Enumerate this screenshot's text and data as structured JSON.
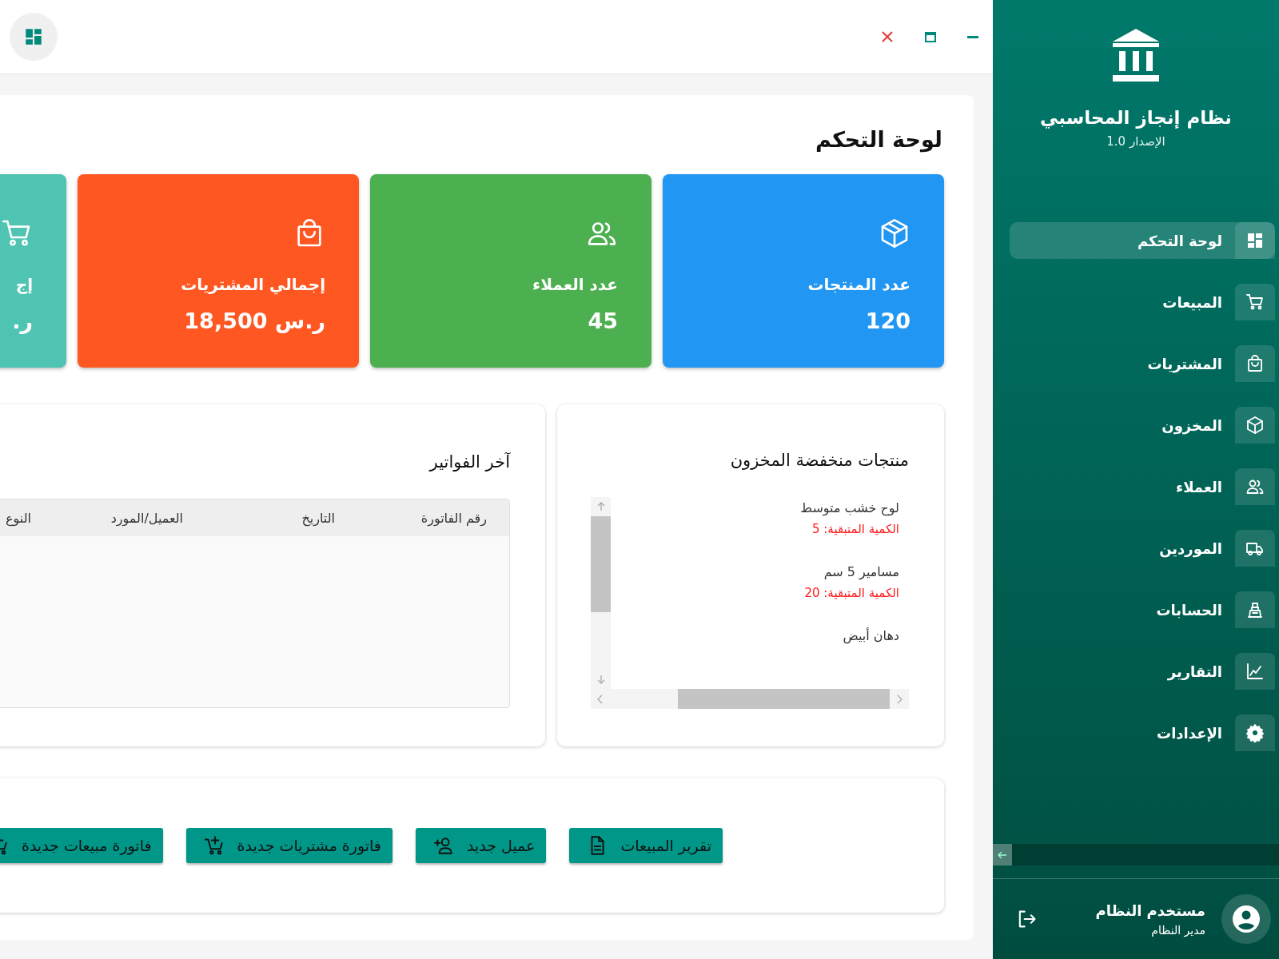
{
  "window_controls": [
    {
      "kind": "close"
    },
    {
      "kind": "maximize"
    },
    {
      "kind": "minimize"
    }
  ],
  "page_title": "لوحة التحكم",
  "stat_cards": [
    {
      "kind": "box",
      "title": "عدد المنتجات",
      "value": "120",
      "color": "#2196f3"
    },
    {
      "kind": "people",
      "title": "عدد العملاء",
      "value": "45",
      "color": "#4caf50"
    },
    {
      "kind": "bag",
      "title": "إجمالي المشتريات",
      "value": "ر.س 18,500",
      "color": "#ff5722"
    },
    {
      "kind": "cart",
      "title": "إج",
      "value": "ر.",
      "color": "#4fc4b3"
    }
  ],
  "low_stock": {
    "title": "منتجات منخفضة المخزون",
    "items": [
      {
        "name": "لوح خشب متوسط",
        "quantity": "الكمية المتبقية: 5"
      },
      {
        "name": "مسامير 5 سم",
        "quantity": "الكمية المتبقية: 20"
      },
      {
        "name": "دهان أبيض"
      }
    ]
  },
  "recent_invoices": {
    "title": "آخر الفواتير",
    "columns": [
      "رقم الفاتورة",
      "التاريخ",
      "العميل/المورد",
      "النوع"
    ]
  },
  "quick_actions": [
    {
      "kind": "report",
      "label": "تقرير المبيعات"
    },
    {
      "kind": "add-person",
      "label": "عميل جديد"
    },
    {
      "kind": "add-cart",
      "label": "فاتورة مشتريات جديدة"
    },
    {
      "kind": "add-cart",
      "label": "فاتورة مبيعات جديدة"
    }
  ],
  "sidebar": {
    "app_title": "نظام إنجاز المحاسبي",
    "version": "الإصدار 1.0",
    "items": [
      {
        "kind": "dashboard",
        "label": "لوحة التحكم",
        "selected": true
      },
      {
        "kind": "cart",
        "label": "المبيعات",
        "selected": false
      },
      {
        "kind": "bag",
        "label": "المشتريات",
        "selected": false
      },
      {
        "kind": "box",
        "label": "المخزون",
        "selected": false
      },
      {
        "kind": "people",
        "label": "العملاء",
        "selected": false
      },
      {
        "kind": "truck",
        "label": "الموردين",
        "selected": false
      },
      {
        "kind": "register",
        "label": "الحسابات",
        "selected": false
      },
      {
        "kind": "chart",
        "label": "التقارير",
        "selected": false
      },
      {
        "kind": "gear",
        "label": "الإعدادات",
        "selected": false
      }
    ],
    "user": {
      "name": "مستخدم النظام",
      "role": "مدير النظام"
    }
  }
}
